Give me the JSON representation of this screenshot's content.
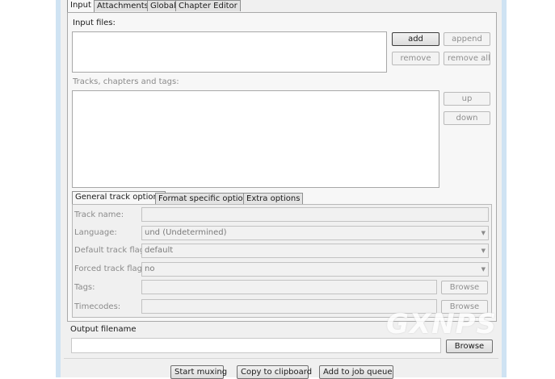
{
  "tabs": [
    "Input",
    "Attachments",
    "Global",
    "Chapter Editor"
  ],
  "input_files": {
    "label": "Input files:",
    "buttons": {
      "add": "add",
      "append": "append",
      "remove": "remove",
      "remove_all": "remove all"
    }
  },
  "tracks": {
    "label": "Tracks, chapters and tags:",
    "buttons": {
      "up": "up",
      "down": "down"
    }
  },
  "subtabs": [
    "General track options",
    "Format specific options",
    "Extra options"
  ],
  "general": {
    "track_name_label": "Track name:",
    "language_label": "Language:",
    "language_value": "und (Undetermined)",
    "default_flag_label": "Default track flag:",
    "default_flag_value": "default",
    "forced_flag_label": "Forced track flag:",
    "forced_flag_value": "no",
    "tags_label": "Tags:",
    "timecodes_label": "Timecodes:",
    "browse": "Browse"
  },
  "output": {
    "label": "Output filename",
    "browse": "Browse"
  },
  "actions": {
    "start": "Start muxing",
    "copy": "Copy to clipboard",
    "queue": "Add to job queue"
  },
  "watermark": "GXNPS"
}
